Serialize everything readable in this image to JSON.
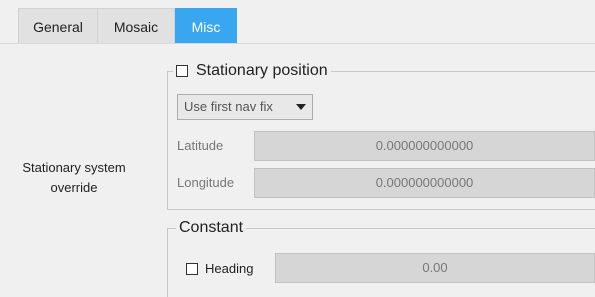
{
  "tabs": [
    {
      "label": "General",
      "active": false
    },
    {
      "label": "Mosaic",
      "active": false
    },
    {
      "label": "Misc",
      "active": true
    }
  ],
  "side_label": {
    "line1": "Stationary system",
    "line2": "override"
  },
  "stationary_group": {
    "title": "Stationary position",
    "checked": false,
    "mode_select": {
      "selected": "Use first nav fix"
    },
    "latitude": {
      "label": "Latitude",
      "value": "0.000000000000"
    },
    "longitude": {
      "label": "Longitude",
      "value": "0.000000000000"
    }
  },
  "constant_group": {
    "title": "Constant",
    "heading": {
      "label": "Heading",
      "checked": false,
      "value": "0.00"
    }
  },
  "colors": {
    "active_tab": "#38a7f0",
    "background": "#f0f0f0",
    "disabled_field": "#d6d6d6"
  }
}
